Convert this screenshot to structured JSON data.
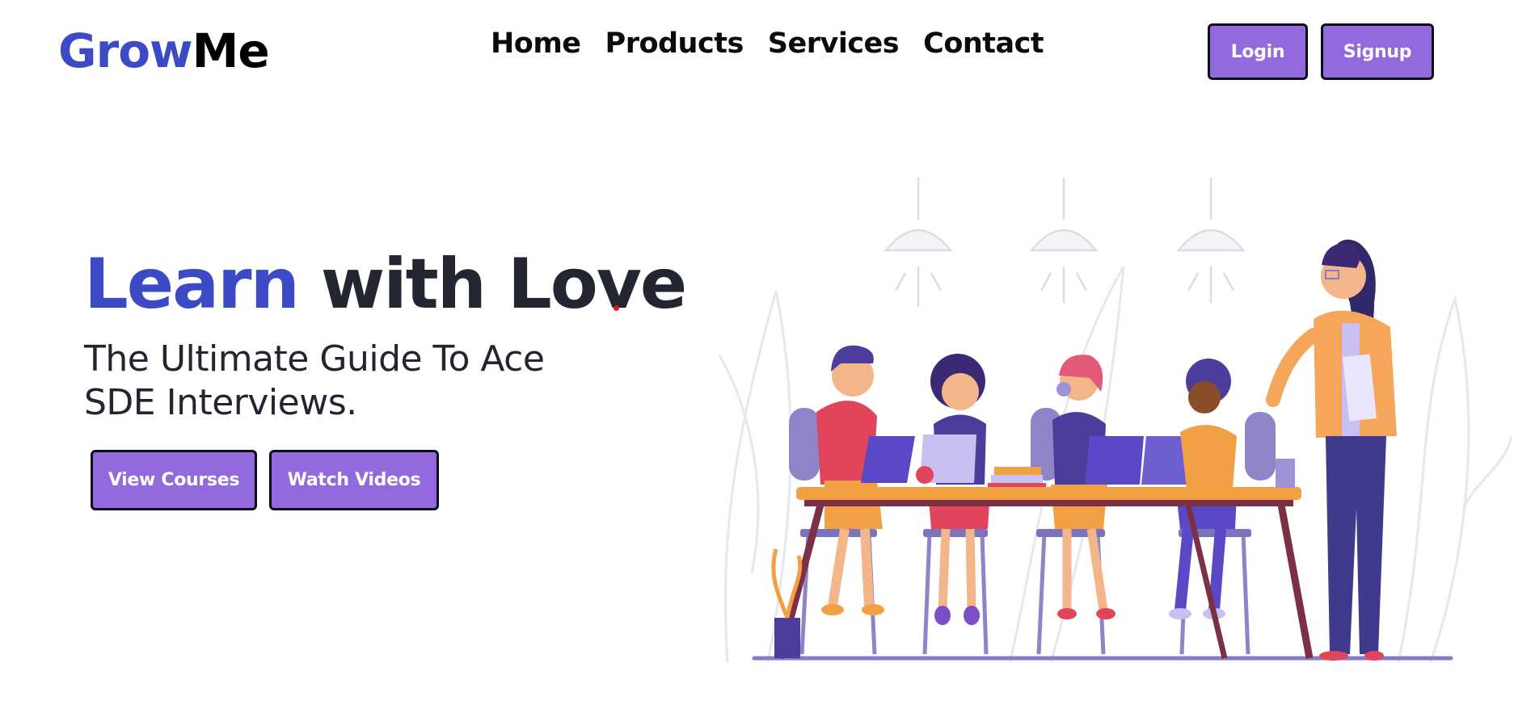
{
  "header": {
    "logo": {
      "part1": "Grow",
      "part2": "Me"
    },
    "nav": [
      "Home",
      "Products",
      "Services",
      "Contact"
    ],
    "login_label": "Login",
    "signup_label": "Signup"
  },
  "hero": {
    "title_word1": "Learn",
    "title_rest": "with Love",
    "subtitle_line1": "The Ultimate Guide To Ace",
    "subtitle_line2": "SDE Interviews.",
    "primary_cta": "View Courses",
    "secondary_cta": "Watch Videos"
  },
  "colors": {
    "brand_blue": "#3c4ac6",
    "button_purple": "#9369de",
    "text_dark": "#232630"
  },
  "illustration": {
    "semantic": "students-studying-with-teacher-illustration"
  }
}
